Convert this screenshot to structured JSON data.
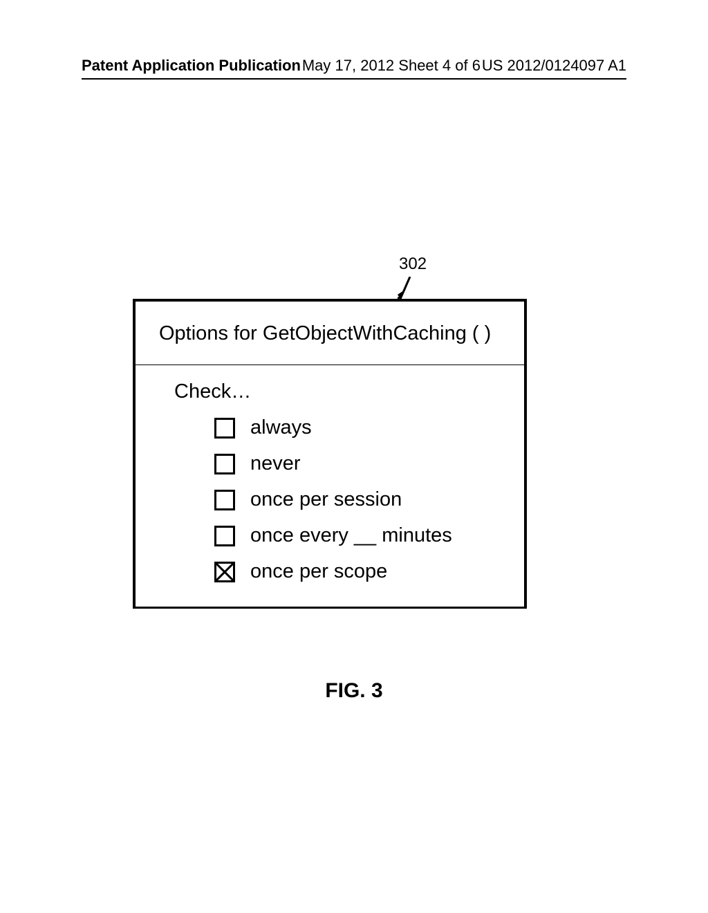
{
  "header": {
    "left": "Patent Application Publication",
    "center": "May 17, 2012  Sheet 4 of 6",
    "right": "US 2012/0124097 A1"
  },
  "figure": {
    "ref_number": "302",
    "caption": "FIG. 3"
  },
  "dialog": {
    "title": "Options for GetObjectWithCaching (  )",
    "check_label": "Check…",
    "options": [
      {
        "label": "always",
        "checked": false
      },
      {
        "label": "never",
        "checked": false
      },
      {
        "label": "once per session",
        "checked": false
      },
      {
        "label": "once every __ minutes",
        "checked": false
      },
      {
        "label": "once per scope",
        "checked": true
      }
    ]
  }
}
